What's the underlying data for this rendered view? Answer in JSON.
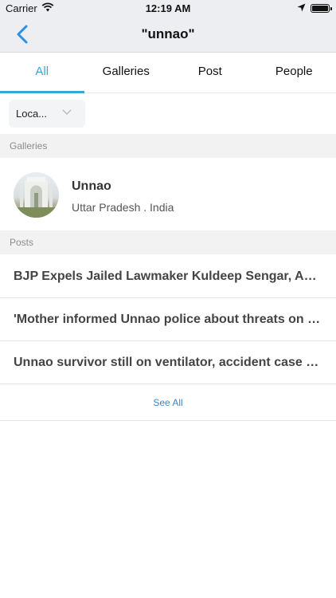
{
  "status_bar": {
    "carrier": "Carrier",
    "time": "12:19 AM",
    "icons": [
      "wifi-icon",
      "location-arrow-icon",
      "battery-icon"
    ]
  },
  "nav": {
    "title": "\"unnao\"",
    "back_icon": "chevron-left-icon",
    "accent_color": "#3aa6d6"
  },
  "tabs": [
    {
      "label": "All",
      "active": true
    },
    {
      "label": "Galleries",
      "active": false
    },
    {
      "label": "Post",
      "active": false
    },
    {
      "label": "People",
      "active": false
    }
  ],
  "filter": {
    "label": "Loca...",
    "icon": "chevron-down-icon"
  },
  "sections": {
    "galleries": "Galleries",
    "posts": "Posts"
  },
  "gallery_item": {
    "name": "Unnao",
    "location": "Uttar Pradesh . India"
  },
  "posts": [
    {
      "title": "BJP Expels Jailed Lawmaker Kuldeep Sengar, Accused..."
    },
    {
      "title": "'Mother informed Unnao police about threats on June..."
    },
    {
      "title": "Unnao survivor still on ventilator, accident case goes to CBI"
    }
  ],
  "see_all_label": "See All"
}
